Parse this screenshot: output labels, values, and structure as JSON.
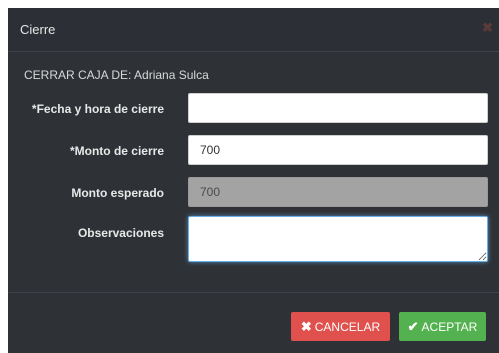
{
  "modal": {
    "title": "Cierre",
    "close_glyph": "✖"
  },
  "cash_register": {
    "label": "CERRAR CAJA DE: Adriana Sulca"
  },
  "fields": {
    "close_datetime": {
      "label": "*Fecha y hora de cierre",
      "value": ""
    },
    "close_amount": {
      "label": "*Monto de cierre",
      "value": "700"
    },
    "expected_amount": {
      "label": "Monto esperado",
      "value": "700"
    },
    "observations": {
      "label": "Observaciones",
      "value": ""
    }
  },
  "buttons": {
    "cancel": {
      "label": "CANCELAR",
      "icon": "x-icon",
      "glyph": "✖"
    },
    "accept": {
      "label": "ACEPTAR",
      "icon": "check-icon",
      "glyph": "✔"
    }
  },
  "colors": {
    "modal_bg": "#2e3237",
    "cancel": "#e0504c",
    "accept": "#54b14f",
    "readonly_input": "#a3a3a3",
    "focus_border": "#66afe9"
  }
}
